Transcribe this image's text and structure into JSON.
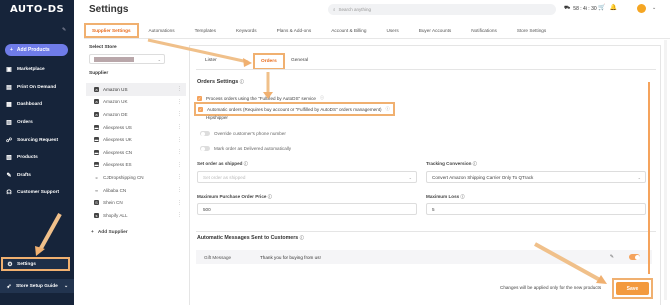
{
  "app": {
    "logo": "AUTO-DS"
  },
  "sidebar": {
    "add_products": "Add Products",
    "items": [
      {
        "label": "Marketplace",
        "icon": "store-icon"
      },
      {
        "label": "Print On Demand",
        "icon": "print-icon"
      },
      {
        "label": "Dashboard",
        "icon": "dashboard-icon"
      },
      {
        "label": "Orders",
        "icon": "orders-icon"
      },
      {
        "label": "Sourcing Request",
        "icon": "sourcing-icon"
      },
      {
        "label": "Products",
        "icon": "products-icon"
      },
      {
        "label": "Drafts",
        "icon": "drafts-icon"
      },
      {
        "label": "Customer Support",
        "icon": "support-icon"
      }
    ],
    "settings": "Settings",
    "setup_guide": "Store Setup Guide"
  },
  "header": {
    "title": "Settings",
    "search_placeholder": "Search anything",
    "timer": "58 : 4i : 30"
  },
  "tabs": [
    "Supplier Settings",
    "Automations",
    "Templates",
    "Keywords",
    "Plans & Add-ons",
    "Account & Billing",
    "Users",
    "Buyer Accounts",
    "Notifications",
    "Store Settings"
  ],
  "store_panel": {
    "select_store_label": "Select Store",
    "supplier_label": "Supplier",
    "suppliers": [
      "Amazon US",
      "Amazon UK",
      "Amazon DE",
      "Aliexpress US",
      "Aliexpress UK",
      "Aliexpress CN",
      "Aliexpress ES",
      "CJDropshipping CN",
      "Alibaba CN",
      "Shein CN",
      "Shopify ALL"
    ],
    "add_supplier": "Add Supplier"
  },
  "subtabs": {
    "lister": "Lister",
    "orders": "Orders",
    "general": "General"
  },
  "orders_settings": {
    "title": "Orders Settings",
    "process_orders": "Process orders using the \"Fulfilled by AutoDS\" service",
    "automatic_orders": "Automatic orders (Requires buy account or \"Fulfilled by AutoDS\" orders management)",
    "hipshipper": "Hipshipper",
    "override_phone": "Override customer's phone number",
    "mark_delivered": "Mark order as Delivered automatically",
    "set_order_label": "Set order as shipped",
    "set_order_placeholder": "Set order as shipped",
    "tracking_label": "Tracking Conversion",
    "tracking_value": "Convert Amazon Shipping Carrier Only To QTrack",
    "max_price_label": "Maximum Purchase Order Price",
    "max_price_value": "500",
    "max_loss_label": "Maximum Loss",
    "max_loss_value": "5"
  },
  "auto_messages": {
    "title": "Automatic Messages Sent to Customers",
    "gift_label": "Gift Message",
    "gift_text": "Thank you for buying from us!"
  },
  "footer": {
    "note": "Changes will be applied only for the new products",
    "save": "Save"
  },
  "colors": {
    "accent": "#e86a1a",
    "highlight": "#f0b070",
    "sidebar": "#16243a",
    "button": "#f39a3e"
  }
}
